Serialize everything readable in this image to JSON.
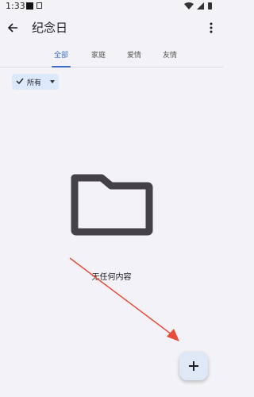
{
  "status_bar": {
    "time": "1:33"
  },
  "app_bar": {
    "title": "纪念日"
  },
  "tabs": [
    {
      "label": "全部",
      "active": true
    },
    {
      "label": "家庭",
      "active": false
    },
    {
      "label": "爱情",
      "active": false
    },
    {
      "label": "友情",
      "active": false
    }
  ],
  "filter": {
    "selected": "所有"
  },
  "empty_state": {
    "message": "无任何内容"
  },
  "fab": {
    "label": "+"
  },
  "colors": {
    "accent": "#3d6cc4",
    "chip_bg": "#dbe9fb",
    "annotation_arrow": "#e74c3c"
  }
}
